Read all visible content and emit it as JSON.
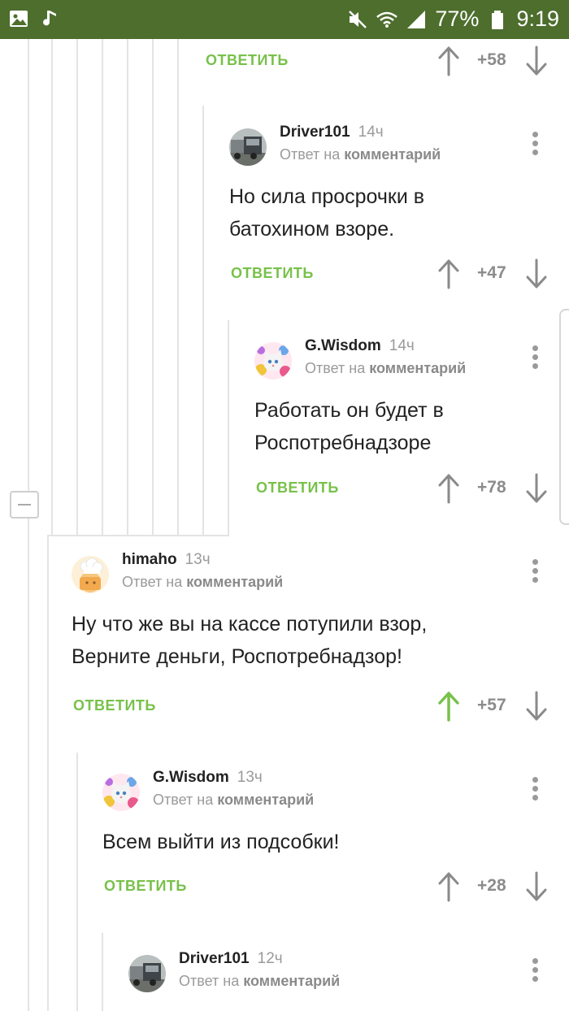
{
  "status_bar": {
    "battery": "77%",
    "time": "9:19",
    "icons": [
      "image-icon",
      "music-note-icon",
      "mute-icon",
      "wifi-icon",
      "signal-icon",
      "battery-icon"
    ]
  },
  "colors": {
    "status_bar": "#4d6e2d",
    "accent": "#78c14a",
    "upvoted": "#78c14a",
    "muted": "#9a9a9a"
  },
  "top_action": {
    "reply_label": "ОТВЕТИТЬ",
    "score": "+58"
  },
  "comments": [
    {
      "username": "Driver101",
      "time": "14ч",
      "reply_prefix": "Ответ на",
      "reply_target": "комментарий",
      "lines": [
        "Но сила просрочки в",
        "батохином взоре."
      ],
      "reply_label": "ОТВЕТИТЬ",
      "score": "+47",
      "avatar": "truck-avatar"
    },
    {
      "username": "G.Wisdom",
      "time": "14ч",
      "reply_prefix": "Ответ на",
      "reply_target": "комментарий",
      "lines": [
        "Работать он будет в",
        "Роспотребнадзоре"
      ],
      "reply_label": "ОТВЕТИТЬ",
      "score": "+78",
      "avatar": "cat-avatar"
    },
    {
      "username": "himaho",
      "time": "13ч",
      "reply_prefix": "Ответ на",
      "reply_target": "комментарий",
      "lines": [
        "Ну что же вы на кассе потупили взор,",
        "Верните деньги, Роспотребнадзор!"
      ],
      "reply_label": "ОТВЕТИТЬ",
      "score": "+57",
      "avatar": "chef-avatar",
      "upvoted": true
    },
    {
      "username": "G.Wisdom",
      "time": "13ч",
      "reply_prefix": "Ответ на",
      "reply_target": "комментарий",
      "lines": [
        "Всем выйти из подсобки!"
      ],
      "reply_label": "ОТВЕТИТЬ",
      "score": "+28",
      "avatar": "cat-avatar"
    },
    {
      "username": "Driver101",
      "time": "12ч",
      "reply_prefix": "Ответ на",
      "reply_target": "комментарий",
      "avatar": "truck-avatar"
    }
  ]
}
